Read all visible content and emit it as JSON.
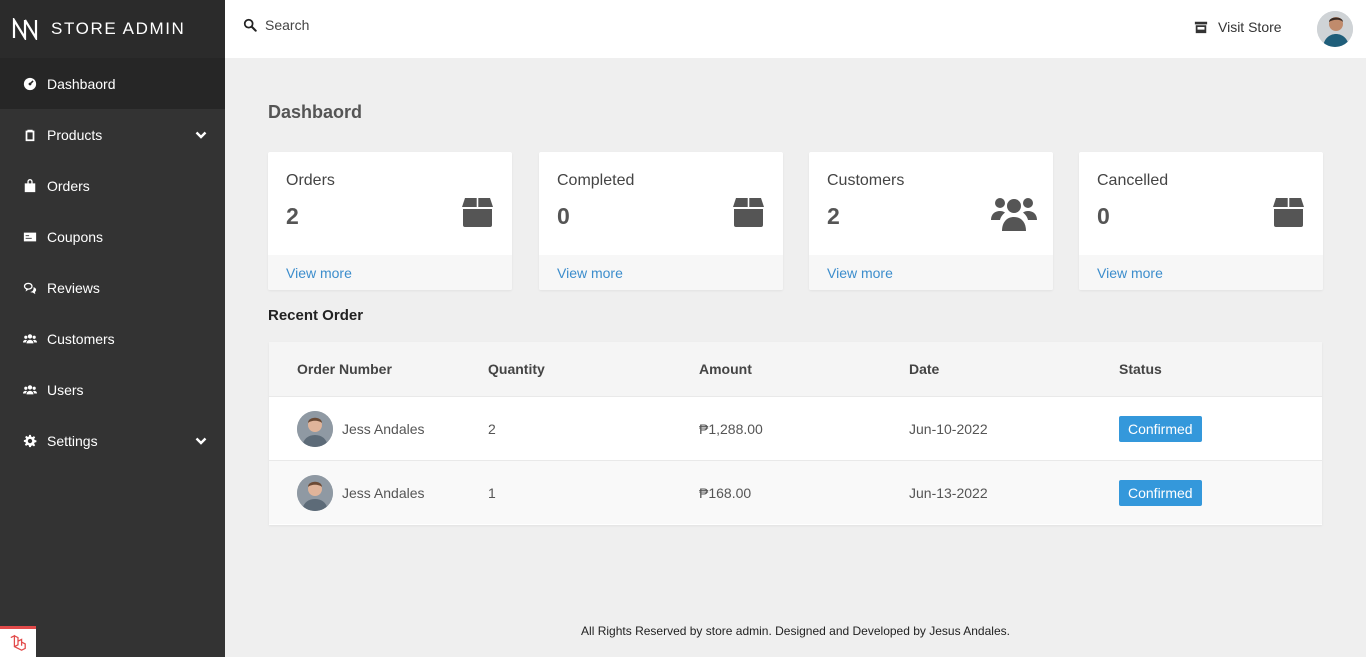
{
  "brand": {
    "name": "STORE ADMIN"
  },
  "sidebar": {
    "items": [
      {
        "label": "Dashbaord",
        "icon": "gauge-icon",
        "active": true
      },
      {
        "label": "Products",
        "icon": "clipboard-icon",
        "has_children": true
      },
      {
        "label": "Orders",
        "icon": "bag-icon"
      },
      {
        "label": "Coupons",
        "icon": "ticket-icon"
      },
      {
        "label": "Reviews",
        "icon": "comments-icon"
      },
      {
        "label": "Customers",
        "icon": "users-icon"
      },
      {
        "label": "Users",
        "icon": "users-icon"
      },
      {
        "label": "Settings",
        "icon": "gear-icon",
        "has_children": true
      }
    ]
  },
  "topbar": {
    "search_placeholder": "Search",
    "visit_store": "Visit Store"
  },
  "main": {
    "title": "Dashbaord",
    "cards": [
      {
        "label": "Orders",
        "count": "2",
        "link": "View more",
        "icon": "box-icon"
      },
      {
        "label": "Completed",
        "count": "0",
        "link": "View more",
        "icon": "box-icon"
      },
      {
        "label": "Customers",
        "count": "2",
        "link": "View more",
        "icon": "users-icon"
      },
      {
        "label": "Cancelled",
        "count": "0",
        "link": "View more",
        "icon": "box-icon"
      }
    ],
    "recent": {
      "title": "Recent Order",
      "columns": [
        "Order Number",
        "Quantity",
        "Amount",
        "Date",
        "Status"
      ],
      "rows": [
        {
          "name": "Jess Andales",
          "quantity": "2",
          "amount": "₱1,288.00",
          "date": "Jun-10-2022",
          "status": "Confirmed"
        },
        {
          "name": "Jess Andales",
          "quantity": "1",
          "amount": "₱168.00",
          "date": "Jun-13-2022",
          "status": "Confirmed"
        }
      ]
    }
  },
  "footer": {
    "text": "All Rights Reserved by store admin. Designed and Developed by Jesus Andales."
  },
  "colors": {
    "sidebar": "#333333",
    "accent": "#3c8dcc",
    "badge": "#3498db"
  }
}
